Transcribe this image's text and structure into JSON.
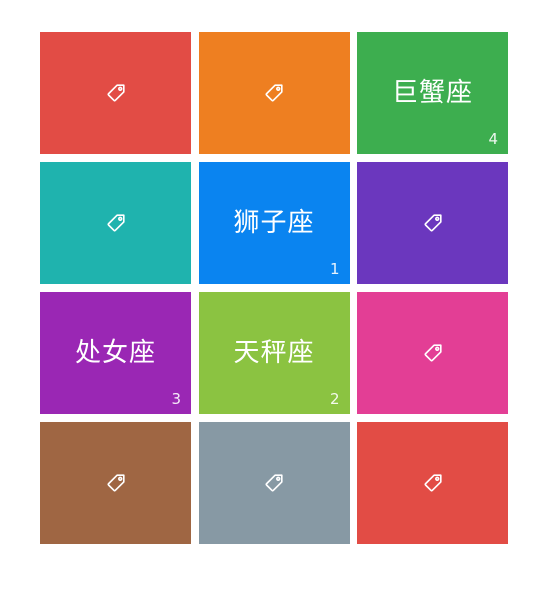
{
  "tiles": [
    {
      "color": "#E24C45",
      "label": "",
      "count": "",
      "icon": "tag-icon"
    },
    {
      "color": "#EE7F21",
      "label": "",
      "count": "",
      "icon": "tag-icon"
    },
    {
      "color": "#3DAE4F",
      "label": "巨蟹座",
      "count": "4",
      "icon": ""
    },
    {
      "color": "#1FB3AE",
      "label": "",
      "count": "",
      "icon": "tag-icon"
    },
    {
      "color": "#0A84F0",
      "label": "狮子座",
      "count": "1",
      "icon": ""
    },
    {
      "color": "#6B37BE",
      "label": "",
      "count": "",
      "icon": "tag-icon"
    },
    {
      "color": "#9A27B4",
      "label": "处女座",
      "count": "3",
      "icon": ""
    },
    {
      "color": "#8BC341",
      "label": "天秤座",
      "count": "2",
      "icon": ""
    },
    {
      "color": "#E33E95",
      "label": "",
      "count": "",
      "icon": "tag-icon"
    },
    {
      "color": "#9F6643",
      "label": "",
      "count": "",
      "icon": "tag-icon"
    },
    {
      "color": "#8799A4",
      "label": "",
      "count": "",
      "icon": "tag-icon"
    },
    {
      "color": "#E24C45",
      "label": "",
      "count": "",
      "icon": "tag-icon"
    }
  ]
}
